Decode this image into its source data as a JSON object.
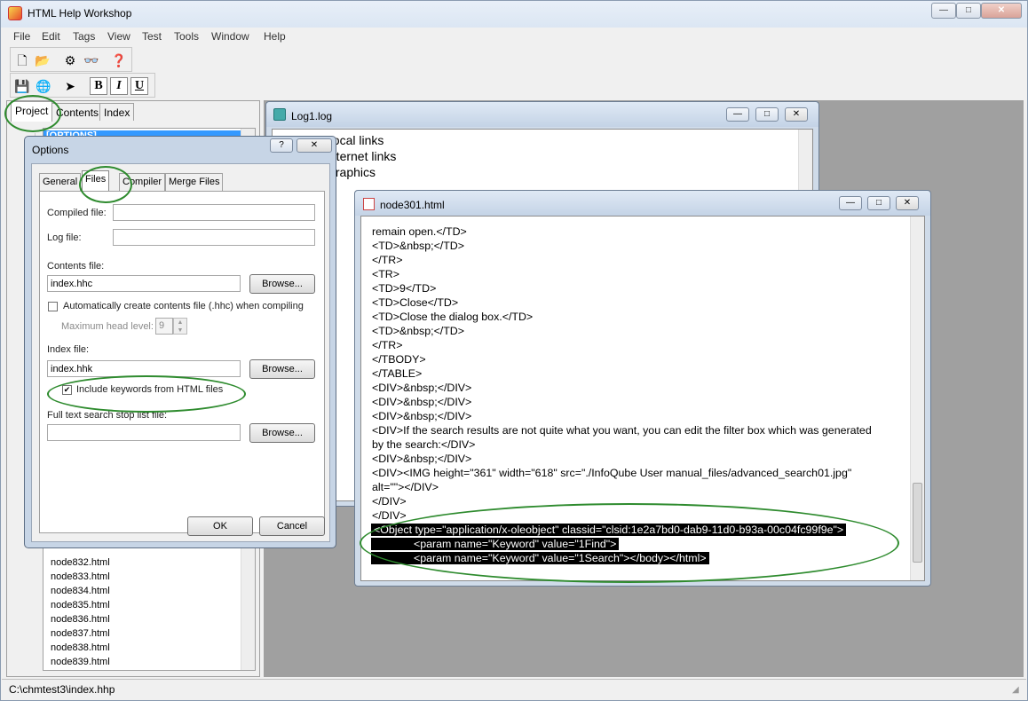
{
  "app": {
    "title": "HTML Help Workshop",
    "menu": [
      "File",
      "Edit",
      "Tags",
      "View",
      "Test",
      "Tools",
      "Window",
      "Help"
    ],
    "caption_buttons": {
      "minimize": "—",
      "maximize": "□",
      "close": "✕"
    }
  },
  "toolbar": {
    "bold_label": "B",
    "italic_label": "I",
    "underline_label": "U"
  },
  "left_pane": {
    "tabs": [
      "Project",
      "Contents",
      "Index"
    ],
    "top_item": "[OPTIONS]",
    "files": [
      "node832.html",
      "node833.html",
      "node834.html",
      "node835.html",
      "node836.html",
      "node837.html",
      "node838.html",
      "node839.html"
    ]
  },
  "log_window": {
    "title": "Log1.log",
    "lines": [
      "Local links",
      "Internet links",
      "Graphics"
    ]
  },
  "node_window": {
    "title": "node301.html",
    "lines": [
      "remain open.</TD>",
      "<TD>&nbsp;</TD>",
      "</TR>",
      "<TR>",
      "<TD>9</TD>",
      "<TD>Close</TD>",
      "<TD>Close the dialog box.</TD>",
      "<TD>&nbsp;</TD>",
      "</TR>",
      "</TBODY>",
      "</TABLE>",
      "<DIV>&nbsp;</DIV>",
      "<DIV>&nbsp;</DIV>",
      "<DIV>&nbsp;</DIV>",
      "<DIV>If the search results are not quite what you want, you can edit the filter box which was generated",
      "by the search:</DIV>",
      "<DIV>&nbsp;</DIV>",
      "<DIV><IMG height=\"361\" width=\"618\" src=\"./InfoQube User manual_files/advanced_search01.jpg\"",
      "alt=\"\"></DIV>",
      "</DIV>",
      "</DIV>"
    ],
    "highlighted": [
      "<Object type=\"application/x-oleobject\" classid=\"clsid:1e2a7bd0-dab9-11d0-b93a-00c04fc99f9e\">",
      "<param name=\"Keyword\" value=\"1Find\">",
      "<param name=\"Keyword\" value=\"1Search\"></body></html>"
    ]
  },
  "options_dialog": {
    "title": "Options",
    "help_button": "?",
    "close_button": "✕",
    "tabs": [
      "General",
      "Files",
      "Compiler",
      "Merge Files"
    ],
    "compiled_file_label": "Compiled file:",
    "compiled_file_value": "",
    "log_file_label": "Log file:",
    "log_file_value": "",
    "contents_file_label": "Contents file:",
    "contents_file_value": "index.hhc",
    "browse_label": "Browse...",
    "auto_create_label": "Automatically create contents file (.hhc) when compiling",
    "auto_create_checked": false,
    "max_head_label": "Maximum head level:",
    "max_head_value": "9",
    "index_file_label": "Index file:",
    "index_file_value": "index.hhk",
    "include_keywords_label": "Include keywords from HTML files",
    "include_keywords_checked": true,
    "stoplist_label": "Full text search stop list file:",
    "stoplist_value": "",
    "ok_label": "OK",
    "cancel_label": "Cancel"
  },
  "status_bar": {
    "path": "C:\\chmtest3\\index.hhp"
  },
  "colors": {
    "annotation": "#2e8b2e",
    "selection": "#3399ff",
    "highlight_bg": "#000000"
  }
}
